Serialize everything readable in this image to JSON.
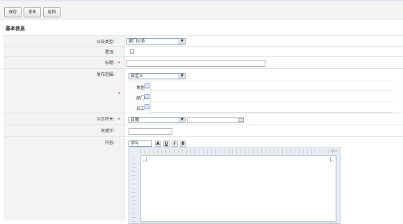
{
  "toolbar": {
    "save_label": "保存",
    "publish_label": "发布",
    "back_label": "返回"
  },
  "section": {
    "title": "基本信息"
  },
  "form": {
    "type_label": "公告类型:",
    "type_value": "部门公告",
    "pinned_label": "置顶:",
    "title_label": "标题:",
    "scope_label": "发布范围:",
    "scope_value": "自定义",
    "role_label": "角色",
    "dept_label": "部门",
    "staff_label": "员工",
    "duration_label": "公示时长:",
    "duration_value": "日期",
    "keyword_label": "关键字:",
    "content_label": "内容:",
    "font_size_value": "字号",
    "required_mark": "*"
  },
  "editor_toolbar": {
    "bold": "B",
    "italic": "I",
    "underline": "U",
    "font": "A"
  },
  "editor": {
    "corner_text": "13px"
  },
  "colors": {
    "required": "#dd0000",
    "label_bg": "#f3f3f3",
    "toolbar_bg": "#f4f4f4"
  }
}
